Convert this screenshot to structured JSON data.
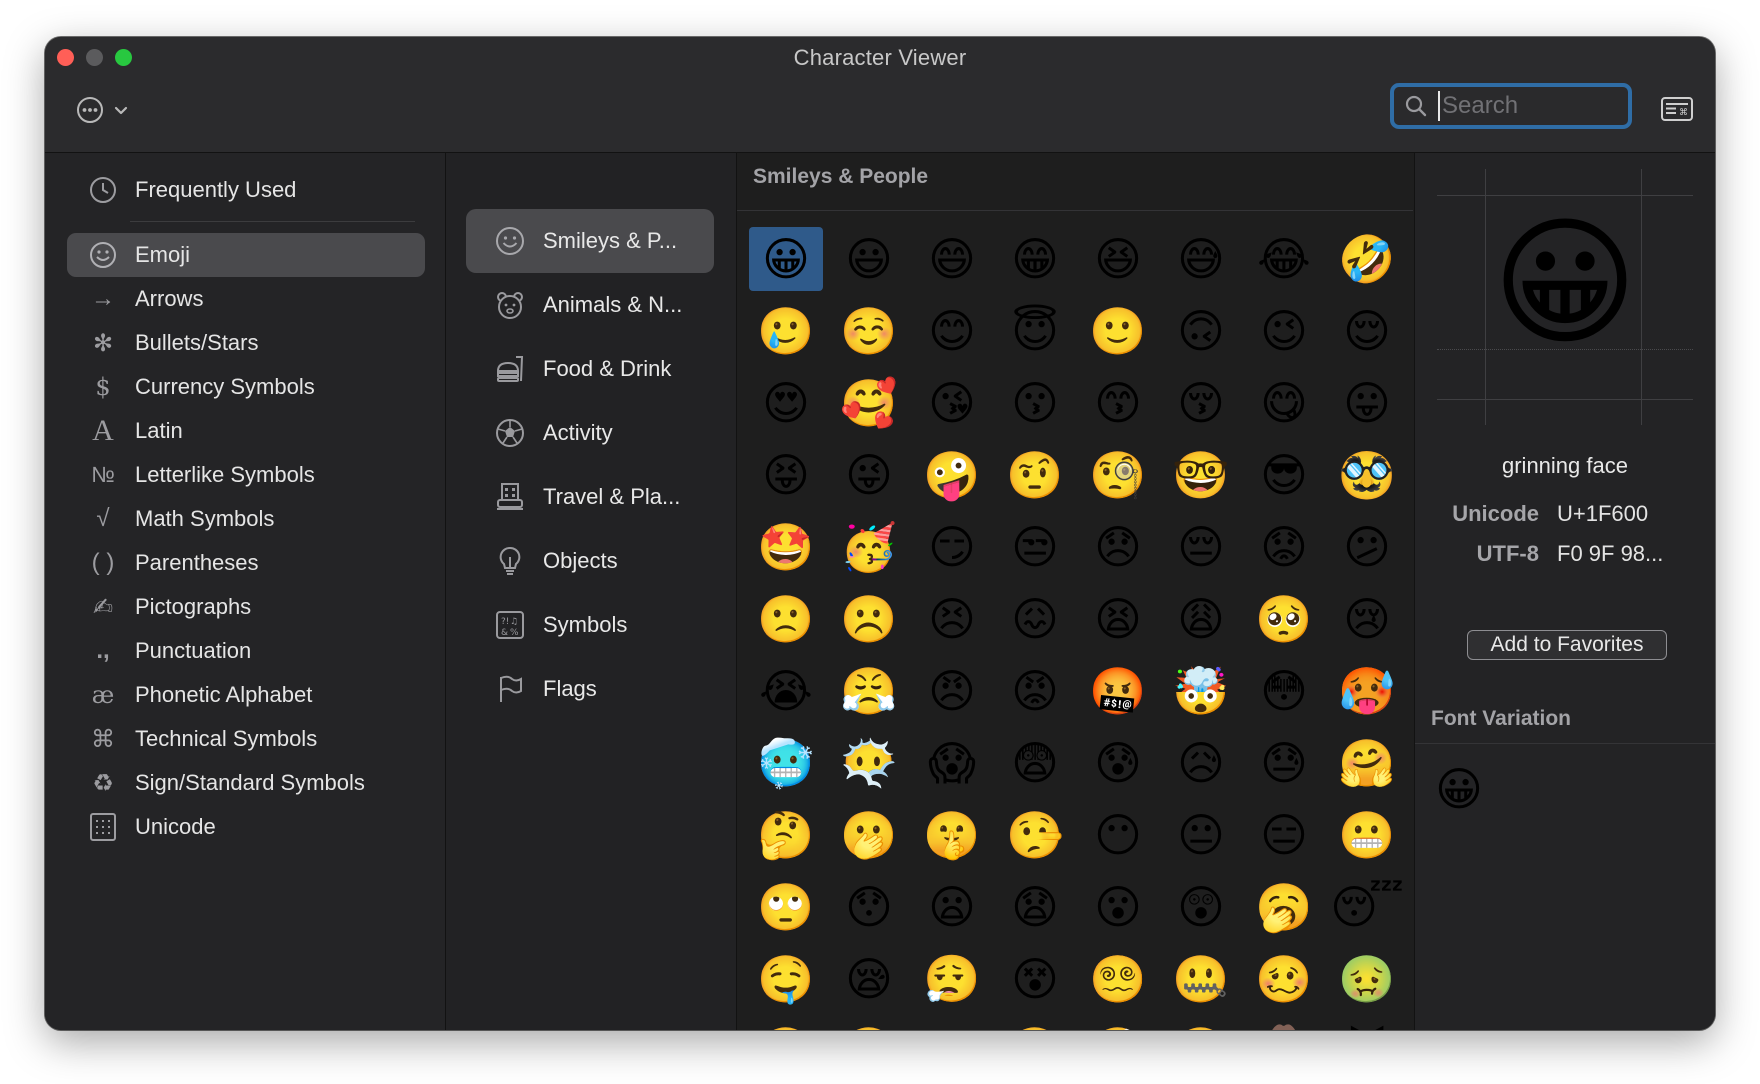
{
  "window": {
    "title": "Character Viewer"
  },
  "toolbar": {
    "search_placeholder": "Search",
    "search_value": ""
  },
  "sidebar": {
    "items": [
      {
        "label": "Frequently Used",
        "icon": "clock-icon"
      },
      {
        "label": "Emoji",
        "icon": "smiley-icon",
        "selected": true
      },
      {
        "label": "Arrows",
        "icon": "arrow-icon"
      },
      {
        "label": "Bullets/Stars",
        "icon": "asterisk-icon"
      },
      {
        "label": "Currency Symbols",
        "icon": "dollar-icon"
      },
      {
        "label": "Latin",
        "icon": "latin-a-icon"
      },
      {
        "label": "Letterlike Symbols",
        "icon": "numero-icon"
      },
      {
        "label": "Math Symbols",
        "icon": "square-root-icon"
      },
      {
        "label": "Parentheses",
        "icon": "parentheses-icon"
      },
      {
        "label": "Pictographs",
        "icon": "pictograph-icon"
      },
      {
        "label": "Punctuation",
        "icon": "punctuation-icon"
      },
      {
        "label": "Phonetic Alphabet",
        "icon": "ae-ligature-icon"
      },
      {
        "label": "Technical Symbols",
        "icon": "command-key-icon"
      },
      {
        "label": "Sign/Standard Symbols",
        "icon": "recycle-icon"
      },
      {
        "label": "Unicode",
        "icon": "unicode-grid-icon"
      }
    ]
  },
  "categories": {
    "items": [
      {
        "label": "Smileys & P...",
        "icon": "smiley-outline-icon",
        "selected": true
      },
      {
        "label": "Animals & N...",
        "icon": "bear-icon"
      },
      {
        "label": "Food & Drink",
        "icon": "burger-drink-icon"
      },
      {
        "label": "Activity",
        "icon": "soccer-ball-icon"
      },
      {
        "label": "Travel & Pla...",
        "icon": "building-icon"
      },
      {
        "label": "Objects",
        "icon": "lightbulb-icon"
      },
      {
        "label": "Symbols",
        "icon": "symbols-icon"
      },
      {
        "label": "Flags",
        "icon": "flag-icon"
      }
    ]
  },
  "grid": {
    "header": "Smileys & People",
    "emojis": [
      "😀",
      "😃",
      "😄",
      "😁",
      "😆",
      "😅",
      "😂",
      "🤣",
      "🥲",
      "☺️",
      "😊",
      "😇",
      "🙂",
      "🙃",
      "😉",
      "😌",
      "😍",
      "🥰",
      "😘",
      "😗",
      "😙",
      "😚",
      "😋",
      "😛",
      "😝",
      "😜",
      "🤪",
      "🤨",
      "🧐",
      "🤓",
      "😎",
      "🥸",
      "🤩",
      "🥳",
      "😏",
      "😒",
      "😞",
      "😔",
      "😟",
      "😕",
      "🙁",
      "☹️",
      "😣",
      "😖",
      "😫",
      "😩",
      "🥺",
      "😢",
      "😭",
      "😤",
      "😠",
      "😡",
      "🤬",
      "🤯",
      "😳",
      "🥵",
      "🥶",
      "😶‍🌫️",
      "😱",
      "😨",
      "😰",
      "😥",
      "😓",
      "🤗",
      "🤔",
      "🫢",
      "🤫",
      "🤥",
      "😶",
      "😐",
      "😑",
      "😬",
      "🙄",
      "😯",
      "😦",
      "😧",
      "😮",
      "😲",
      "🥱",
      "😴",
      "🤤",
      "😪",
      "😮‍💨",
      "😵",
      "😵‍💫",
      "🤐",
      "🥴",
      "🤢",
      "🤮",
      "🤧",
      "😷",
      "🤒",
      "🤕",
      "🤑",
      "🤠",
      "😈"
    ]
  },
  "detail": {
    "glyph": "😀",
    "name": "grinning face",
    "unicode_label": "Unicode",
    "unicode_value": "U+1F600",
    "utf8_label": "UTF-8",
    "utf8_value": "F0 9F 98...",
    "favorites_button": "Add to Favorites",
    "font_variation_title": "Font Variation",
    "font_variation_glyph": "😀"
  },
  "colors": {
    "accent_blue": "#2f6da6",
    "selection_blue": "#2f5a8a",
    "close_red": "#ff5f57",
    "zoom_green": "#28c840"
  }
}
